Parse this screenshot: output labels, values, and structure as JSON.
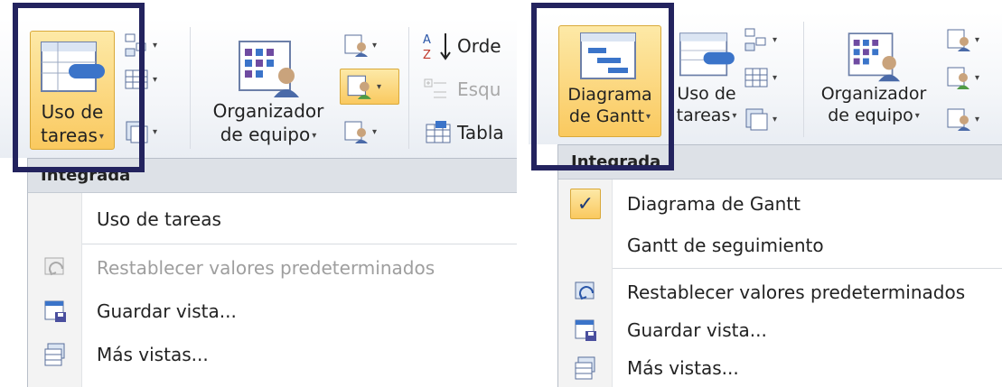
{
  "left": {
    "ribbon": {
      "uso_label_1": "Uso de",
      "uso_label_2": "tareas",
      "organizador_label_1": "Organizador",
      "organizador_label_2": "de equipo",
      "ordenar_label": "Orde",
      "esquema_label": "Esqu",
      "tabla_label": "Tabla"
    },
    "menu": {
      "header": "Integrada",
      "items": [
        {
          "label": "Uso de tareas",
          "icon": "none"
        },
        {
          "label": "Restablecer valores predeterminados",
          "icon": "reset-view-icon",
          "disabled": true
        },
        {
          "label": "Guardar vista...",
          "icon": "save-view-icon"
        },
        {
          "label": "Más vistas...",
          "icon": "more-views-icon"
        }
      ]
    }
  },
  "right": {
    "ribbon": {
      "gantt_label_1": "Diagrama",
      "gantt_label_2": "de Gantt",
      "uso_label_1": "Uso de",
      "uso_label_2": "tareas",
      "organizador_label_1": "Organizador",
      "organizador_label_2": "de equipo"
    },
    "menu": {
      "header": "Integrada",
      "items": [
        {
          "label": "Diagrama de Gantt",
          "icon": "check-icon",
          "checked": true
        },
        {
          "label": "Gantt de seguimiento",
          "icon": "none"
        },
        {
          "label": "Restablecer valores predeterminados",
          "icon": "reset-view-icon"
        },
        {
          "label": "Guardar vista...",
          "icon": "save-view-icon"
        },
        {
          "label": "Más vistas...",
          "icon": "more-views-icon"
        }
      ]
    }
  },
  "colors": {
    "highlight_border": "#23235e",
    "active_button": "#fac95f",
    "menu_header_bg": "#dde1e7"
  }
}
